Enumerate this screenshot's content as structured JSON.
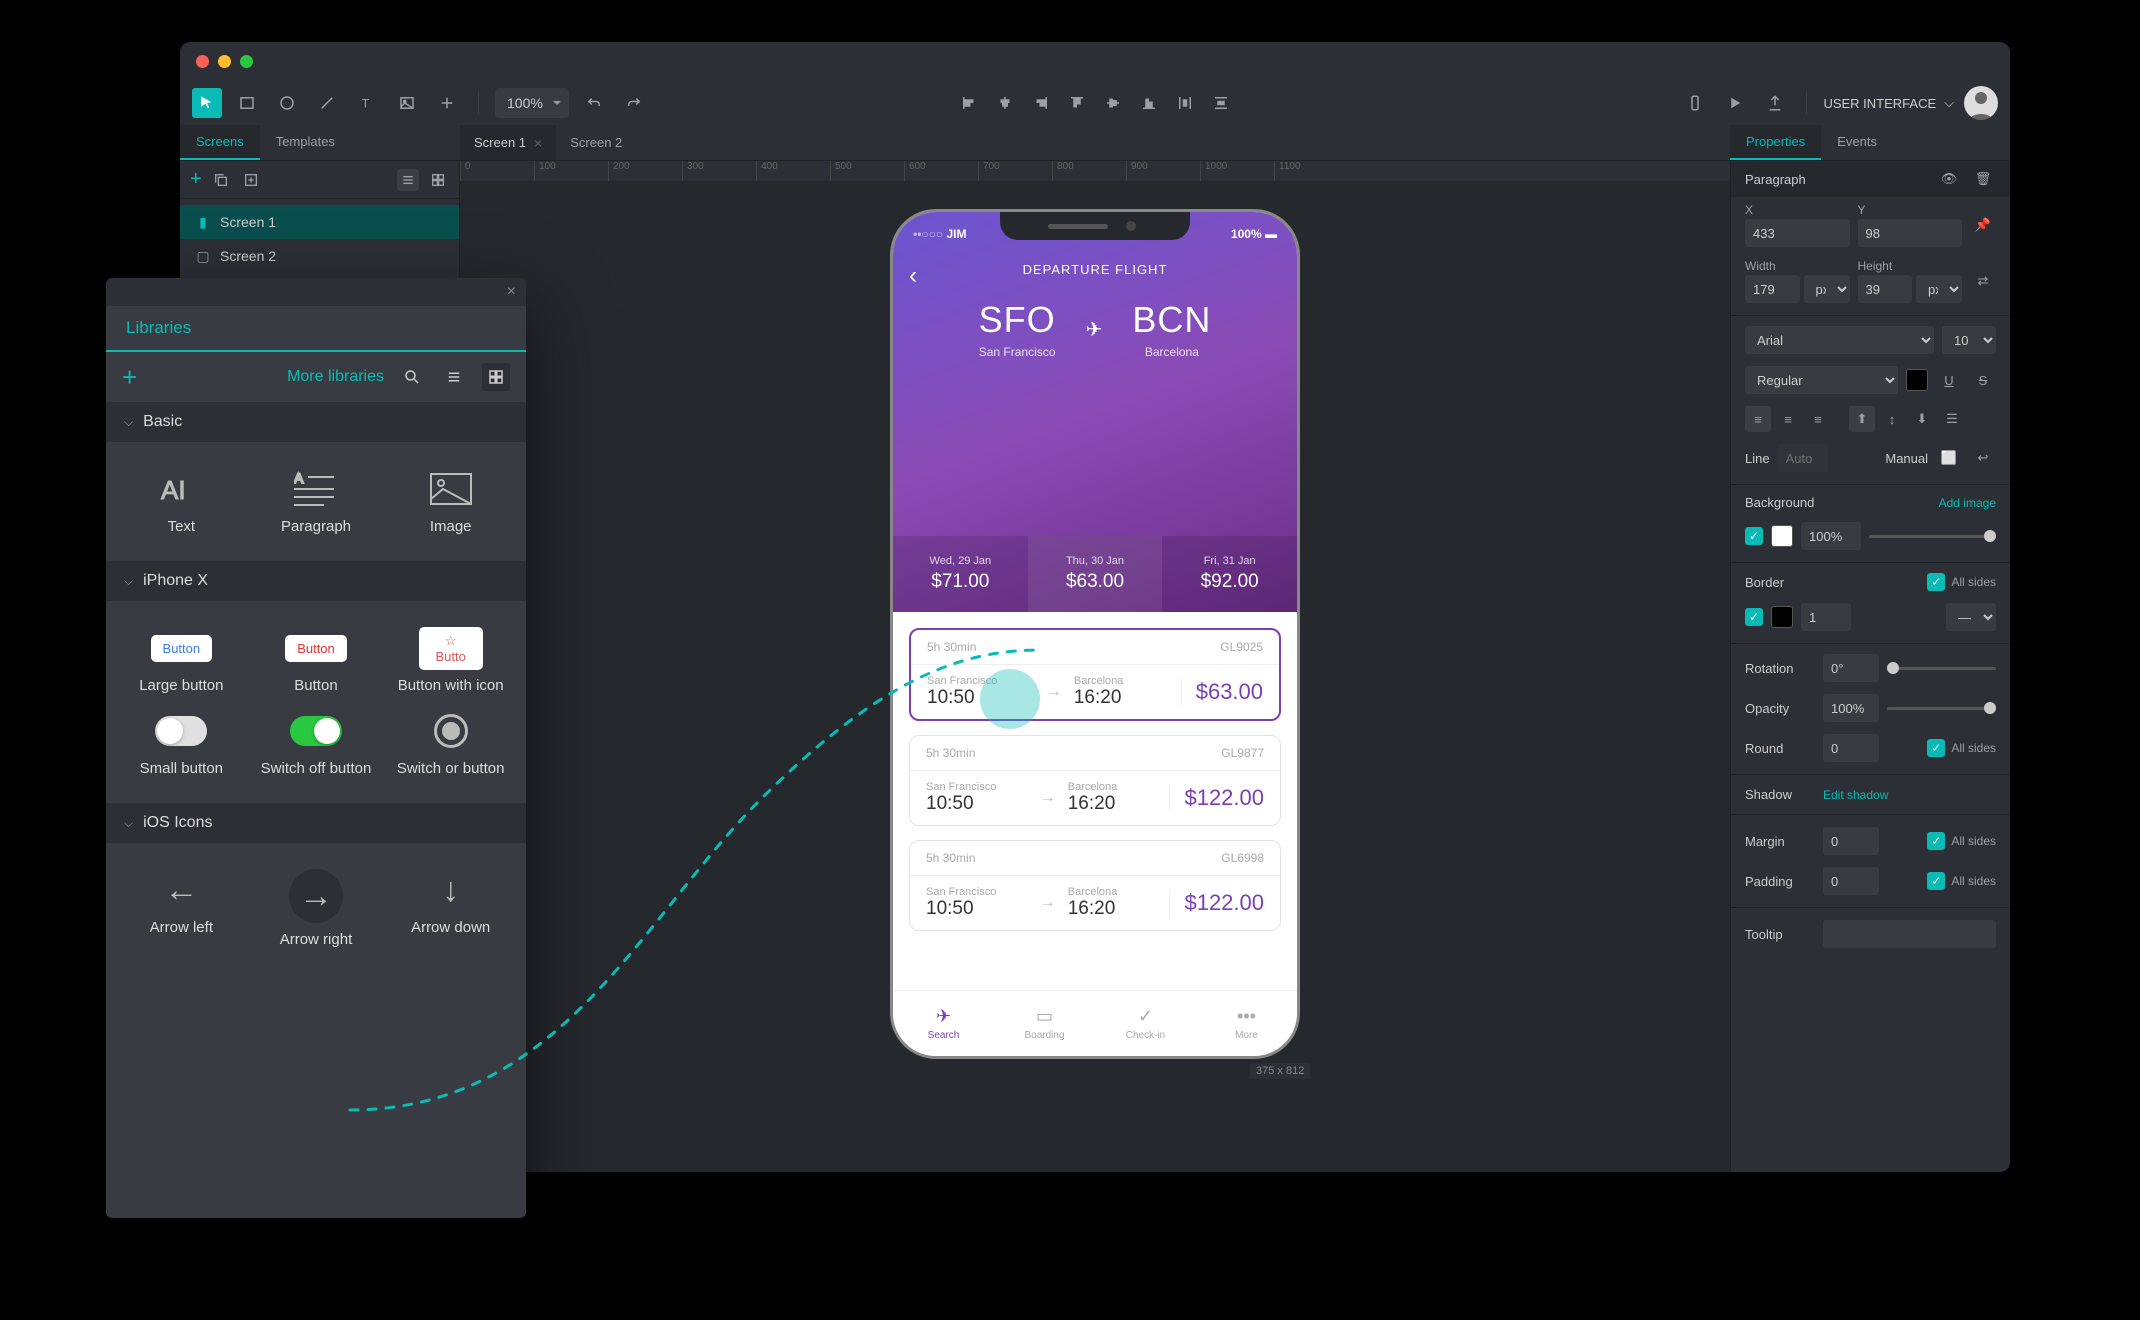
{
  "toolbar": {
    "zoom": "100%",
    "project_name": "USER INTERFACE"
  },
  "tabs": {
    "left": [
      "Screens",
      "Templates"
    ],
    "center": [
      {
        "label": "Screen 1",
        "active": true
      },
      {
        "label": "Screen 2",
        "active": false
      }
    ],
    "right": [
      "Properties",
      "Events"
    ]
  },
  "screen_tree": {
    "items": [
      {
        "label": "Screen 1",
        "type": "screen"
      },
      {
        "label": "Screen 2",
        "type": "template"
      }
    ]
  },
  "ruler_ticks": [
    "0",
    "100",
    "200",
    "300",
    "400",
    "500",
    "600",
    "700",
    "800",
    "900",
    "1000",
    "1100"
  ],
  "canvas_dim": "375 x 812",
  "phone": {
    "carrier": "JIM",
    "battery": "100%",
    "title": "DEPARTURE FLIGHT",
    "origin": {
      "code": "SFO",
      "city": "San Francisco"
    },
    "destination": {
      "code": "BCN",
      "city": "Barcelona"
    },
    "dates": [
      {
        "date": "Wed, 29 Jan",
        "price": "$71.00"
      },
      {
        "date": "Thu, 30 Jan",
        "price": "$63.00",
        "active": true
      },
      {
        "date": "Fri, 31 Jan",
        "price": "$92.00"
      }
    ],
    "flights": [
      {
        "duration": "5h 30min",
        "code": "GL9025",
        "from": "San Francisco",
        "dep": "10:50",
        "to": "Barcelona",
        "arr": "16:20",
        "price": "$63.00",
        "selected": true
      },
      {
        "duration": "5h 30min",
        "code": "GL9877",
        "from": "San Francisco",
        "dep": "10:50",
        "to": "Barcelona",
        "arr": "16:20",
        "price": "$122.00"
      },
      {
        "duration": "5h 30min",
        "code": "GL6998",
        "from": "San Francisco",
        "dep": "10:50",
        "to": "Barcelona",
        "arr": "16:20",
        "price": "$122.00"
      }
    ],
    "nav": [
      {
        "label": "Search",
        "active": true
      },
      {
        "label": "Boarding"
      },
      {
        "label": "Check-in"
      },
      {
        "label": "More"
      }
    ]
  },
  "properties": {
    "element": "Paragraph",
    "x": "433",
    "y": "98",
    "width": "179",
    "width_unit": "px",
    "height": "39",
    "height_unit": "px",
    "font": "Arial",
    "font_size": "10",
    "weight": "Regular",
    "line_label": "Line",
    "line_auto": "Auto",
    "line_manual": "Manual",
    "background_label": "Background",
    "add_image": "Add image",
    "bg_color": "#ffffff",
    "bg_opacity": "100%",
    "border_label": "Border",
    "all_sides": "All sides",
    "border_color": "#000000",
    "border_width": "1",
    "rotation_label": "Rotation",
    "rotation": "0°",
    "opacity_label": "Opacity",
    "opacity": "100%",
    "round_label": "Round",
    "round": "0",
    "shadow_label": "Shadow",
    "edit_shadow": "Edit shadow",
    "margin_label": "Margin",
    "margin": "0",
    "padding_label": "Padding",
    "padding": "0",
    "tooltip_label": "Tooltip"
  },
  "libraries": {
    "title": "Libraries",
    "more": "More libraries",
    "sections": {
      "basic": {
        "title": "Basic",
        "items": [
          "Text",
          "Paragraph",
          "Image"
        ]
      },
      "iphonex": {
        "title": "iPhone X",
        "items": [
          "Large button",
          "Button",
          "Button with icon",
          "Small button",
          "Switch off button",
          "Switch or button"
        ]
      },
      "ios_icons": {
        "title": "iOS Icons",
        "items": [
          "Arrow left",
          "Arrow right",
          "Arrow down"
        ]
      }
    }
  }
}
